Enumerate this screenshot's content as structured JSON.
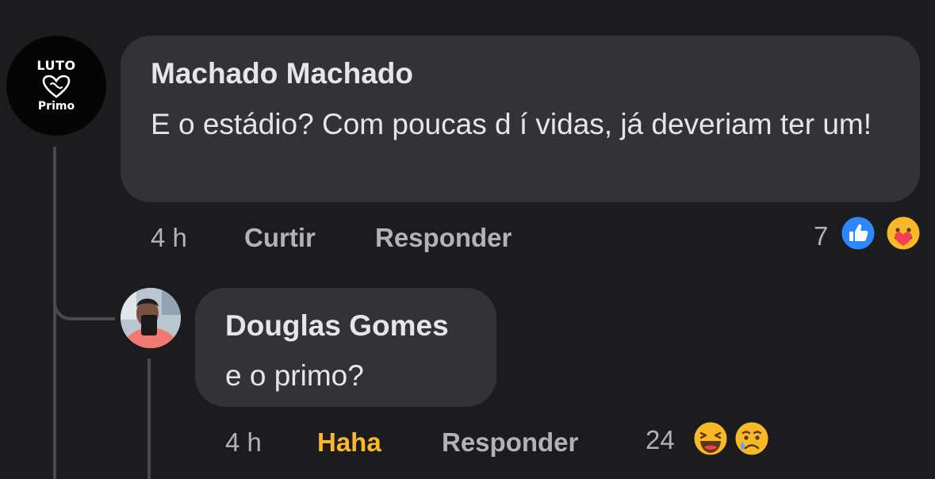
{
  "comments": [
    {
      "author": "Machado Machado",
      "text": "E o estádio? Com poucas d í vidas, já deveriam ter um!",
      "avatar_text": {
        "top": "LUTO",
        "bottom": "Primo"
      },
      "time": "4 h",
      "like_label": "Curtir",
      "reply_label": "Responder",
      "reaction_count": "7",
      "reactions": [
        "like-icon",
        "care-icon"
      ]
    }
  ],
  "replies": [
    {
      "author": "Douglas Gomes",
      "text": "e o primo?",
      "time": "4 h",
      "like_label": "Haha",
      "reply_label": "Responder",
      "reaction_count": "24",
      "reactions": [
        "haha-icon",
        "sad-icon"
      ]
    }
  ],
  "colors": {
    "background": "#1c1c1e",
    "bubble": "#333336",
    "text": "#e4e6eb",
    "secondary_text": "#b0b3b8",
    "like_blue": "#2d88ff",
    "haha_yellow": "#f7b928"
  }
}
